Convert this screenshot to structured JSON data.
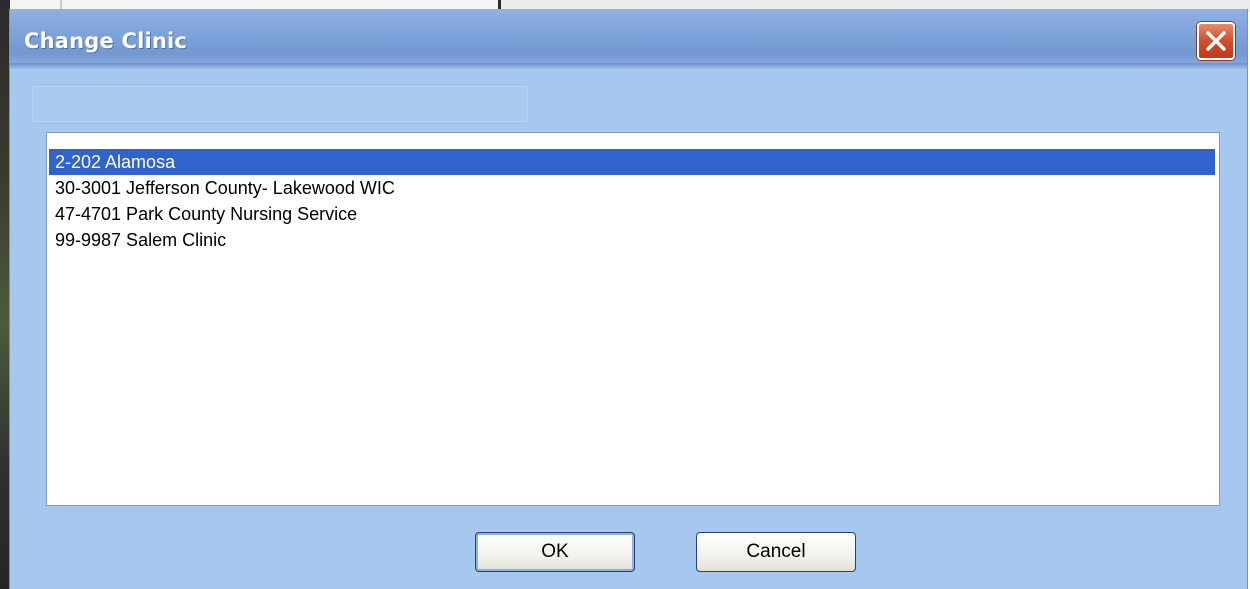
{
  "dialog": {
    "title": "Change Clinic",
    "close_icon": "close-icon",
    "accent_color": "#3163cc"
  },
  "clinic_list": {
    "selected_index": 0,
    "items": [
      {
        "label": "2-202 Alamosa"
      },
      {
        "label": "30-3001 Jefferson County- Lakewood WIC"
      },
      {
        "label": "47-4701 Park County Nursing Service"
      },
      {
        "label": "99-9987 Salem Clinic"
      }
    ]
  },
  "buttons": {
    "ok_label": "OK",
    "cancel_label": "Cancel"
  }
}
